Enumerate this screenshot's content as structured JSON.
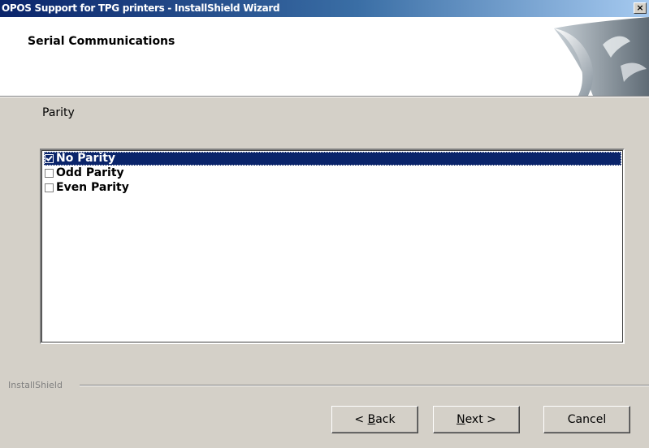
{
  "window": {
    "title": "OPOS Support for TPG printers - InstallShield Wizard",
    "close_glyph": "✕"
  },
  "header": {
    "heading": "Serial Communications",
    "art_icon": "wizard-page-curl-graphic"
  },
  "section": {
    "label": "Parity"
  },
  "list": {
    "items": [
      {
        "label": "No Parity",
        "checked": true,
        "selected": true
      },
      {
        "label": "Odd Parity",
        "checked": false,
        "selected": false
      },
      {
        "label": "Even Parity",
        "checked": false,
        "selected": false
      }
    ]
  },
  "footer": {
    "brand": "InstallShield"
  },
  "buttons": {
    "back": {
      "prefix": "< ",
      "accel": "B",
      "rest": "ack"
    },
    "next": {
      "accel": "N",
      "rest": "ext",
      "suffix": " >"
    },
    "cancel": "Cancel"
  },
  "colors": {
    "titlebar_start": "#0a246a",
    "titlebar_end": "#a6caf0",
    "selection": "#0a246a",
    "dialog_face": "#d4d0c8"
  }
}
